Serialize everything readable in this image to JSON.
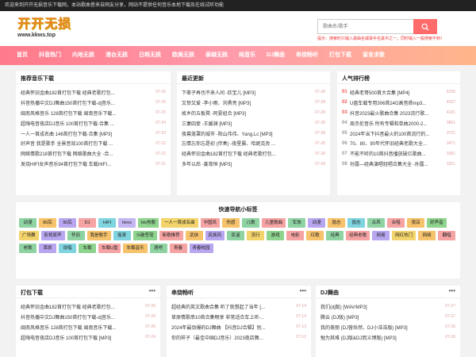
{
  "topbar": {
    "notice": "欢迎来到开开无损音乐下载网，本站歌曲皆来自网友分享，网站不提供任何音乐本地下载及在线试听功能"
  },
  "logo": {
    "title": "开开无损",
    "url": "www.kkws.top"
  },
  "search": {
    "placeholder": "歌曲名/歌手",
    "hint": "提示：搜索时只输入歌曲名或歌手名其中之一，同时输入一般搜索不到！"
  },
  "nav": [
    "首页",
    "抖音热门",
    "内地无损",
    "港台无损",
    "日韩无损",
    "欧美无损",
    "泰越无损",
    "纯音乐",
    "DJ舞曲",
    "串烧畅听",
    "打包下载",
    "留言求歌"
  ],
  "recommend": {
    "title": "推荐音乐下载",
    "items": [
      {
        "text": "经典怀旧金曲182首打包下载 经典老歌打包...",
        "date": "07-26"
      },
      {
        "text": "抖音热播中文DJ舞曲150首打包下载-dj音乐...",
        "date": "07-26"
      },
      {
        "text": "闽南风格音乐 128首打包下载 闽南音乐下载...",
        "date": "07-25"
      },
      {
        "text": "超嗨电音夜店DJ音乐 100首打包下载-合集 ...",
        "date": "07-24"
      },
      {
        "text": "一人一首成名曲 146首打包下载-合集 [MP3]",
        "date": "07-23"
      },
      {
        "text": "好声音 我是歌手 全景音效100首打包下载 ...",
        "date": "07-22"
      },
      {
        "text": "网络情歌218首打包下载 网络歌曲大全 -合...",
        "date": "07-22"
      },
      {
        "text": "发烧HIFI女声音乐94首打包下载 车载HIFI...",
        "date": "07-21"
      }
    ]
  },
  "latest": {
    "title": "最近更新",
    "items": [
      {
        "text": "下辈子再也不来人间 -欣宝儿 [MP3]",
        "date": "07-28"
      },
      {
        "text": "又惊又爱 -李小雨、刘勇亮 [MP3]",
        "date": "07-28"
      },
      {
        "text": "故乡的五板凳 -阿夏组合 [MP3]",
        "date": "07-28"
      },
      {
        "text": "三妻四妾 -王媛渊 [MP3]",
        "date": "07-28"
      },
      {
        "text": "夜幕笼罩的城市 -阳山伟伟、Yang.Lc [MP3]",
        "date": "07-28"
      },
      {
        "text": "忘情忘你忘是初 (伴奏) -夜星晨、哈妮克孜 ...",
        "date": "07-28"
      },
      {
        "text": "经典怀旧金曲182首打包下载 经典老歌打包...",
        "date": "07-28"
      },
      {
        "text": "多年以后 -姜育恒 [MP3]",
        "date": "07-28"
      }
    ]
  },
  "ranking": {
    "title": "人气排行榜",
    "items": [
      {
        "num": "01",
        "text": "经典老哥500首大合集 [MP4]",
        "date": "6236"
      },
      {
        "num": "02",
        "text": "U盘车载专用306首24G高音质mp3...",
        "date": "4337"
      },
      {
        "num": "03",
        "text": "抖音2023最火歌曲合集 2023流行歌...",
        "date": "4181"
      },
      {
        "num": "04",
        "text": "周杰伦音乐 所有专辑和单曲2000-2...",
        "date": "3861"
      },
      {
        "num": "05",
        "text": "2024年当下抖音最火的100首流行的...",
        "date": "3721"
      },
      {
        "num": "06",
        "text": "70、80、90年代怀旧经典老歌大全...",
        "date": "3471"
      },
      {
        "num": "07",
        "text": "不能不听的10首抖音播放破亿歌曲...",
        "date": "3381"
      },
      {
        "num": "08",
        "text": "孙露—经典演唱轻唱合集大全 -孙露...",
        "date": "3251"
      }
    ]
  },
  "tags": {
    "title": "快速导航小标签",
    "items": [
      "动漫",
      "80后",
      "90后",
      "DJ",
      "HIFI",
      "hires",
      "ktv热歌",
      "一人一首成名曲",
      "中国风",
      "伤感",
      "儿歌",
      "儿童歌曲",
      "军旅",
      "动漫",
      "励志",
      "励志",
      "古风",
      "合唱",
      "夜店",
      "好声音",
      "广场舞",
      "影视原声",
      "怀旧",
      "我是歌手",
      "摇滚",
      "斗破苍穹",
      "新歌推荐",
      "武侠",
      "民族风",
      "民谣",
      "流行",
      "游戏",
      "电影",
      "红歌",
      "经典",
      "经典老歌",
      "网易",
      "网红热门",
      "网络",
      "翻唱",
      "老歌",
      "草原",
      "说唱",
      "车载",
      "车载U盘",
      "车载音乐",
      "酒吧",
      "青春",
      "青春校园"
    ],
    "colors": [
      "#8fd3a3",
      "#f6c26b",
      "#b8a6f0",
      "#f5a3a3",
      "#7fd4e0",
      "#c4b5f3",
      "#8ed38e",
      "#f3d36b",
      "#f5a3a3",
      "#f6c26b",
      "#8fd3a3",
      "#f5a3a3",
      "#8fd3a3",
      "#b8a6f0",
      "#f6c26b",
      "#7fd4e0",
      "#8fd3a3",
      "#f5a3a3",
      "#f6c26b",
      "#8ed38e",
      "#f3d36b",
      "#b8a6f0",
      "#8fd3a3",
      "#f6c26b",
      "#7fd4e0",
      "#8ed38e",
      "#f5a3a3",
      "#f6c26b",
      "#b8a6f0",
      "#8fd3a3",
      "#f3d36b",
      "#8ed38e",
      "#f5a3a3",
      "#f6c26b",
      "#8fd3a3",
      "#f5a3a3",
      "#b8a6f0",
      "#f3d36b",
      "#f6c26b",
      "#f5a3a3",
      "#8fd3a3",
      "#b8a6f0",
      "#7fd4e0",
      "#8ed38e",
      "#f5a3a3",
      "#f6c26b",
      "#8fd3a3",
      "#f5a3a3",
      "#b8a6f0"
    ]
  },
  "pack": {
    "title": "打包下载",
    "items": [
      {
        "text": "经典怀旧金曲182首打包下载 经典老歌打包...",
        "date": "07-26"
      },
      {
        "text": "抖音热播中文DJ舞曲150首打包下载-dj音乐...",
        "date": "07-26"
      },
      {
        "text": "闽南风格音乐 128首打包下载 闽南音乐下载...",
        "date": "07-25"
      },
      {
        "text": "超嗨电音夜店DJ音乐 100首打包下载 [MP3]",
        "date": "07-24"
      }
    ]
  },
  "medley": {
    "title": "串烧畅听",
    "items": [
      {
        "text": "超经典的英文歌曲合集 听了就想起了当年 [...",
        "date": "07-14"
      },
      {
        "text": "草原情歌串10首合集畅享 非常适合车上听-...",
        "date": "07-14"
      },
      {
        "text": "2024年最劲爆的DJ舞曲 【抖音DJ合辑】别...",
        "date": "07-13"
      },
      {
        "text": "你的样子（最佳中国DJ音乐）2023夜店舞...",
        "date": "07-12"
      }
    ]
  },
  "dj": {
    "title": "DJ舞曲",
    "items": [
      {
        "text": "我们(dj版) [WAV/MP3]",
        "date": "07-27"
      },
      {
        "text": "腾云 (DJ版) [MP3]",
        "date": "07-27"
      },
      {
        "text": "我的美丽 (DJ营岳然、DJ小浩浩版) [MP3]",
        "date": "07-26"
      },
      {
        "text": "勉为其难 (DJ版&DJ而义博版) [MP3]",
        "date": "07-26"
      }
    ]
  },
  "colors": {
    "accent": "#ff6a6a",
    "nav_start": "#ff7a8a",
    "nav_end": "#ffb68a",
    "topbar": "#222222"
  }
}
